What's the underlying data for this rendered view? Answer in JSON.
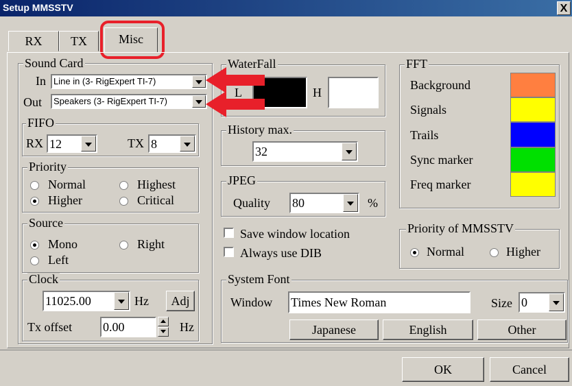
{
  "window": {
    "title": "Setup MMSSTV",
    "close_label": "X"
  },
  "tabs": [
    {
      "label": "RX",
      "selected": false
    },
    {
      "label": "TX",
      "selected": false
    },
    {
      "label": "Misc",
      "selected": true
    }
  ],
  "sound_card": {
    "legend": "Sound Card",
    "in_label": "In",
    "in_value": "Line in (3- RigExpert TI-7)",
    "out_label": "Out",
    "out_value": "Speakers (3- RigExpert TI-7)"
  },
  "fifo": {
    "legend": "FIFO",
    "rx_label": "RX",
    "rx_value": "12",
    "tx_label": "TX",
    "tx_value": "8"
  },
  "priority": {
    "legend": "Priority",
    "options": [
      {
        "label": "Normal",
        "selected": false
      },
      {
        "label": "Highest",
        "selected": false
      },
      {
        "label": "Higher",
        "selected": true
      },
      {
        "label": "Critical",
        "selected": false
      }
    ]
  },
  "source": {
    "legend": "Source",
    "options": [
      {
        "label": "Mono",
        "selected": true
      },
      {
        "label": "Right",
        "selected": false
      },
      {
        "label": "Left",
        "selected": false
      }
    ]
  },
  "clock": {
    "legend": "Clock",
    "value": "11025.00",
    "unit": "Hz",
    "adj_label": "Adj",
    "tx_offset_label": "Tx offset",
    "tx_offset_value": "0.00",
    "tx_offset_unit": "Hz"
  },
  "waterfall": {
    "legend": "WaterFall",
    "l_label": "L",
    "h_label": "H",
    "l_color": "#000000",
    "h_color": "#ffffff"
  },
  "history": {
    "legend": "History max.",
    "value": "32"
  },
  "jpeg": {
    "legend": "JPEG",
    "quality_label": "Quality",
    "quality_value": "80",
    "unit": "%"
  },
  "options": {
    "save_window_location": {
      "label": "Save window location",
      "checked": false
    },
    "always_use_dib": {
      "label": "Always use DIB",
      "checked": false
    }
  },
  "fft": {
    "legend": "FFT",
    "items": [
      {
        "label": "Background",
        "color": "#ff7f40"
      },
      {
        "label": "Signals",
        "color": "#ffff00"
      },
      {
        "label": "Trails",
        "color": "#0000ff"
      },
      {
        "label": "Sync marker",
        "color": "#00e000"
      },
      {
        "label": "Freq marker",
        "color": "#ffff00"
      }
    ]
  },
  "priority_mmsstv": {
    "legend": "Priority of MMSSTV",
    "options": [
      {
        "label": "Normal",
        "selected": true
      },
      {
        "label": "Higher",
        "selected": false
      }
    ]
  },
  "system_font": {
    "legend": "System Font",
    "window_label": "Window",
    "window_value": "Times New Roman",
    "size_label": "Size",
    "size_value": "0",
    "buttons": [
      "Japanese",
      "English",
      "Other"
    ]
  },
  "footer": {
    "ok_label": "OK",
    "cancel_label": "Cancel"
  },
  "annotations": {
    "highlight_color": "#e8202a",
    "arrow_color": "#e8202a"
  }
}
